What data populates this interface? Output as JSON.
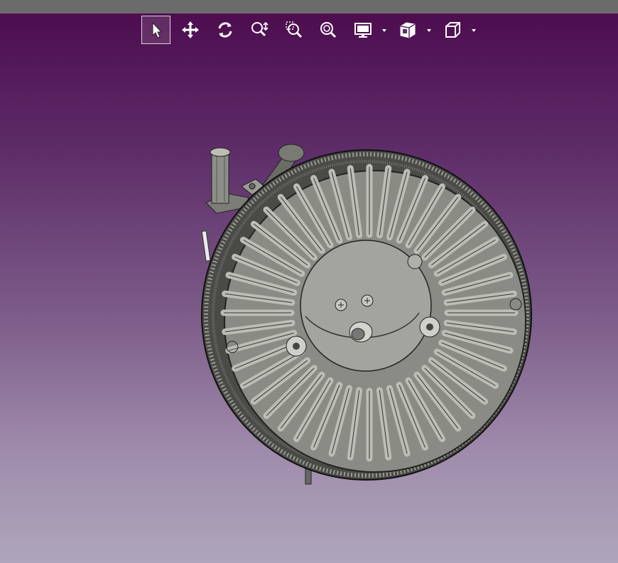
{
  "window": {
    "toolbar_color": "#ffffff",
    "background_top": "#4c0a4d",
    "background_bottom": "#aea6bc"
  },
  "toolbar": {
    "buttons": [
      {
        "name": "select-tool",
        "icon": "arrow-pointer-icon",
        "active": true
      },
      {
        "name": "pan-tool",
        "icon": "move-arrows-icon",
        "active": false
      },
      {
        "name": "rotate-tool",
        "icon": "rotate-icon",
        "active": false
      },
      {
        "name": "zoom-tool",
        "icon": "zoom-in-out-icon",
        "active": false
      },
      {
        "name": "zoom-box-tool",
        "icon": "zoom-box-icon",
        "active": false
      },
      {
        "name": "zoom-fit-tool",
        "icon": "zoom-fit-icon",
        "active": false
      },
      {
        "name": "display-mode",
        "icon": "monitor-icon",
        "dropdown": true
      },
      {
        "name": "section-view",
        "icon": "section-cube-icon",
        "dropdown": true
      },
      {
        "name": "view-orientation",
        "icon": "cube-icon",
        "dropdown": true
      }
    ]
  },
  "model": {
    "type": "3d-cad-part",
    "description_visible": false,
    "fill_color": "#8a8a84",
    "edge_color": "#222222"
  }
}
